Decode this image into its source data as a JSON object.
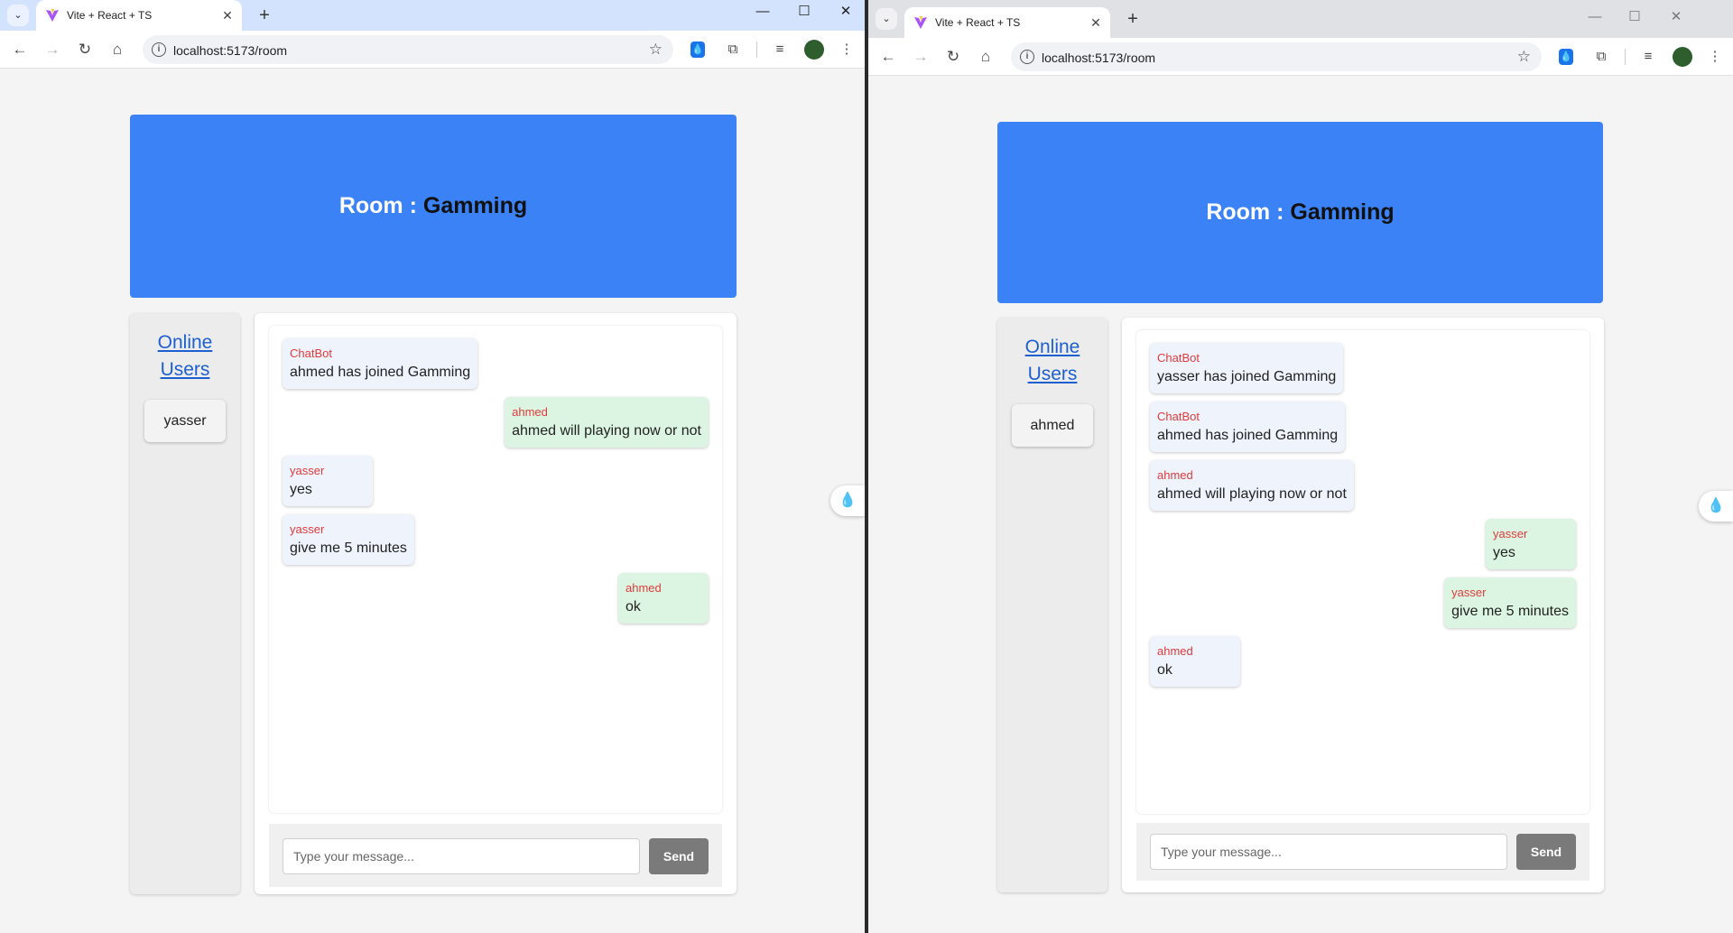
{
  "colors": {
    "header_blue": "#3b82f6",
    "chatbot_red": "#e03b3b",
    "mine_green": "#dcf5e2",
    "other_blue": "#eef3fc",
    "send_gray": "#7a7a7a"
  },
  "browser": {
    "tab_title": "Vite + React + TS",
    "url": "localhost:5173/room",
    "icons": [
      "tab-search-icon",
      "vite-favicon-icon",
      "close-icon",
      "plus-icon",
      "minimize-icon",
      "maximize-icon",
      "back-icon",
      "forward-icon",
      "reload-icon",
      "home-icon",
      "info-icon",
      "star-icon",
      "extension-drop-icon",
      "puzzle-icon",
      "media-icon",
      "profile-icon",
      "menu-icon"
    ]
  },
  "glyphs": {
    "back": "←",
    "forward": "→",
    "reload": "↻",
    "home": "⌂",
    "star": "☆",
    "close": "✕",
    "plus": "+",
    "minimize": "—",
    "maximize": "☐",
    "menu": "⋮",
    "puzzle": "⧉",
    "media": "≡",
    "info": "i",
    "drop": "💧",
    "chevron": "⌄"
  },
  "left": {
    "room_prefix": "Room : ",
    "room_name": "Gamming",
    "sidebar_title": "Online Users",
    "online_user": "yasser",
    "messages": [
      {
        "user": "ChatBot",
        "text": "ahmed has joined Gamming"
      },
      {
        "user": "ahmed",
        "text": "ahmed will playing now or not"
      },
      {
        "user": "yasser",
        "text": "yes"
      },
      {
        "user": "yasser",
        "text": "give me 5 minutes"
      },
      {
        "user": "ahmed",
        "text": "ok"
      }
    ],
    "input_placeholder": "Type your message...",
    "send_label": "Send"
  },
  "right": {
    "room_prefix": "Room : ",
    "room_name": "Gamming",
    "sidebar_title": "Online Users",
    "online_user": "ahmed",
    "messages": [
      {
        "user": "ChatBot",
        "text": "yasser has joined Gamming"
      },
      {
        "user": "ChatBot",
        "text": "ahmed has joined Gamming"
      },
      {
        "user": "ahmed",
        "text": "ahmed will playing now or not"
      },
      {
        "user": "yasser",
        "text": "yes"
      },
      {
        "user": "yasser",
        "text": "give me 5 minutes"
      },
      {
        "user": "ahmed",
        "text": "ok"
      }
    ],
    "input_placeholder": "Type your message...",
    "send_label": "Send"
  }
}
